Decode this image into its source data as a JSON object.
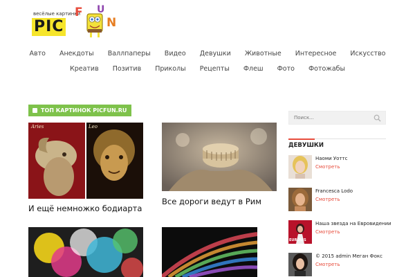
{
  "logo": {
    "tagline": "весёлые картинки",
    "pic": "PIC",
    "fun_letters": [
      "F",
      "U",
      "N"
    ]
  },
  "nav": {
    "row1": [
      "Авто",
      "Анекдоты",
      "Валлпаперы",
      "Видео",
      "Девушки",
      "Животные",
      "Интересное",
      "Искусство"
    ],
    "row2": [
      "Креатив",
      "Позитив",
      "Приколы",
      "Рецепты",
      "Флеш",
      "Фото",
      "Фотожабы"
    ]
  },
  "main": {
    "section_label": "ТОП КАРТИНОК PICFUN.RU",
    "posts": [
      {
        "title": "И ещё немножко бодиарта",
        "image_labels": [
          "Aries",
          "Leo"
        ]
      },
      {
        "title": "Все дороги ведут в Рим"
      },
      {
        "title": ""
      },
      {
        "title": ""
      }
    ]
  },
  "sidebar": {
    "search_placeholder": "Поиск...",
    "heading": "ДЕВУШКИ",
    "items": [
      {
        "title": "Наоми Уоттс",
        "more": "Смотреть"
      },
      {
        "title": "Francesca Lodo",
        "more": "Смотреть"
      },
      {
        "title": "Наша звезда на Евровидении",
        "more": "Смотреть",
        "image_text": "EUROVIS"
      },
      {
        "title": "© 2015 admin Меган Фокс",
        "more": "Смотреть"
      }
    ]
  },
  "colors": {
    "accent_green": "#7ec24b",
    "accent_red": "#e74c3c",
    "logo_yellow": "#f6e52b"
  }
}
